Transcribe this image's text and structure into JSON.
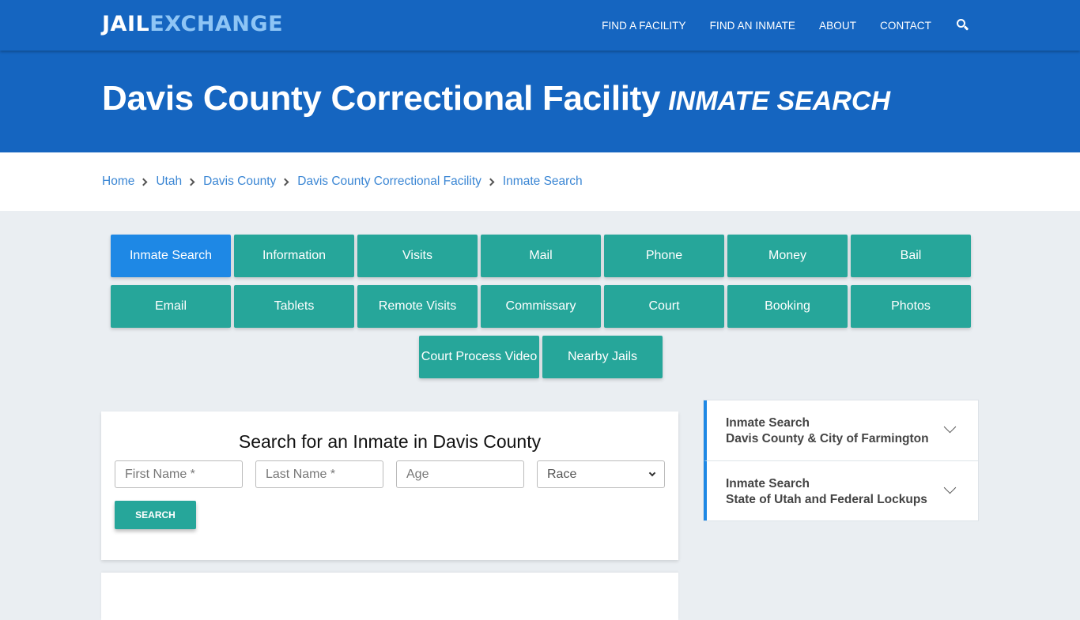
{
  "header": {
    "logo": {
      "part1": "JAIL",
      "part2": "EXCHANGE"
    },
    "nav": [
      {
        "label": "FIND A FACILITY"
      },
      {
        "label": "FIND AN INMATE"
      },
      {
        "label": "ABOUT"
      },
      {
        "label": "CONTACT"
      }
    ],
    "search_icon": "search-icon"
  },
  "hero": {
    "title": "Davis County Correctional Facility",
    "subtitle": "INMATE SEARCH"
  },
  "breadcrumb": [
    {
      "label": "Home"
    },
    {
      "label": "Utah"
    },
    {
      "label": "Davis County"
    },
    {
      "label": "Davis County Correctional Facility"
    },
    {
      "label": "Inmate Search"
    }
  ],
  "tiles": {
    "row1": [
      "Inmate Search",
      "Information",
      "Visits",
      "Mail",
      "Phone",
      "Money",
      "Bail"
    ],
    "row2": [
      "Email",
      "Tablets",
      "Remote Visits",
      "Commissary",
      "Court",
      "Booking",
      "Photos"
    ],
    "row3": [
      "Court Process Video",
      "Nearby Jails"
    ],
    "active": "Inmate Search"
  },
  "search_form": {
    "heading": "Search for an Inmate in Davis County",
    "first_name_placeholder": "First Name *",
    "last_name_placeholder": "Last Name *",
    "age_placeholder": "Age",
    "race_selected": "Race",
    "submit_label": "SEARCH"
  },
  "sidebar": {
    "items": [
      {
        "line1": "Inmate Search",
        "line2": "Davis County & City of Farmington"
      },
      {
        "line1": "Inmate Search",
        "line2": "State of Utah and Federal Lockups"
      }
    ]
  },
  "colors": {
    "brand_blue": "#1565c0",
    "logo_accent": "#8ec5f5",
    "tile_teal": "#26a69a",
    "tile_active": "#1e88e5",
    "link": "#3a86d4"
  }
}
